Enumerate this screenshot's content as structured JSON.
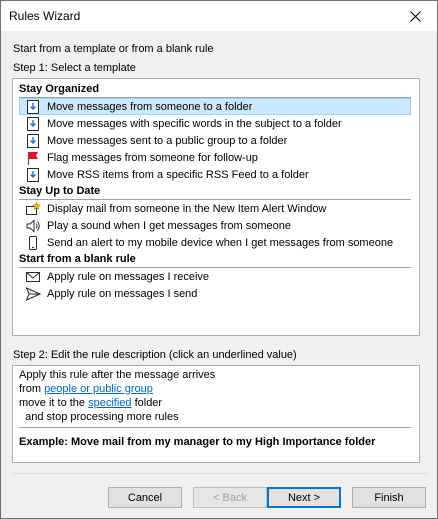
{
  "window": {
    "title": "Rules Wizard"
  },
  "intro_text": "Start from a template or from a blank rule",
  "step1_label": "Step 1: Select a template",
  "templates": {
    "groups": [
      {
        "header": "Stay Organized",
        "items": [
          {
            "label": "Move messages from someone to a folder",
            "icon": "move-to-folder-icon",
            "selected": true
          },
          {
            "label": "Move messages with specific words in the subject to a folder",
            "icon": "move-to-folder-icon",
            "selected": false
          },
          {
            "label": "Move messages sent to a public group to a folder",
            "icon": "move-to-folder-icon",
            "selected": false
          },
          {
            "label": "Flag messages from someone for follow-up",
            "icon": "red-flag-icon",
            "selected": false
          },
          {
            "label": "Move RSS items from a specific RSS Feed to a folder",
            "icon": "move-to-folder-icon",
            "selected": false
          }
        ]
      },
      {
        "header": "Stay Up to Date",
        "items": [
          {
            "label": "Display mail from someone in the New Item Alert Window",
            "icon": "alert-window-icon",
            "selected": false
          },
          {
            "label": "Play a sound when I get messages from someone",
            "icon": "speaker-icon",
            "selected": false
          },
          {
            "label": "Send an alert to my mobile device when I get messages from someone",
            "icon": "mobile-device-icon",
            "selected": false
          }
        ]
      },
      {
        "header": "Start from a blank rule",
        "items": [
          {
            "label": "Apply rule on messages I receive",
            "icon": "envelope-icon",
            "selected": false
          },
          {
            "label": "Apply rule on messages I send",
            "icon": "send-icon",
            "selected": false
          }
        ]
      }
    ]
  },
  "step2_label": "Step 2: Edit the rule description (click an underlined value)",
  "description": {
    "line1": "Apply this rule after the message arrives",
    "line2_prefix": "from ",
    "line2_link": "people or public group",
    "line3_prefix": "move it to the ",
    "line3_link": "specified",
    "line3_suffix": " folder",
    "line4": "  and stop processing more rules",
    "example": "Example: Move mail from my manager to my High Importance folder"
  },
  "buttons": {
    "cancel": "Cancel",
    "back": "< Back",
    "next": "Next >",
    "finish": "Finish"
  },
  "colors": {
    "selection_bg": "#cce8ff",
    "selection_border": "#99d1ff",
    "link": "#0066cc",
    "flag": "#e81123",
    "default_button_border": "#0078d7"
  }
}
